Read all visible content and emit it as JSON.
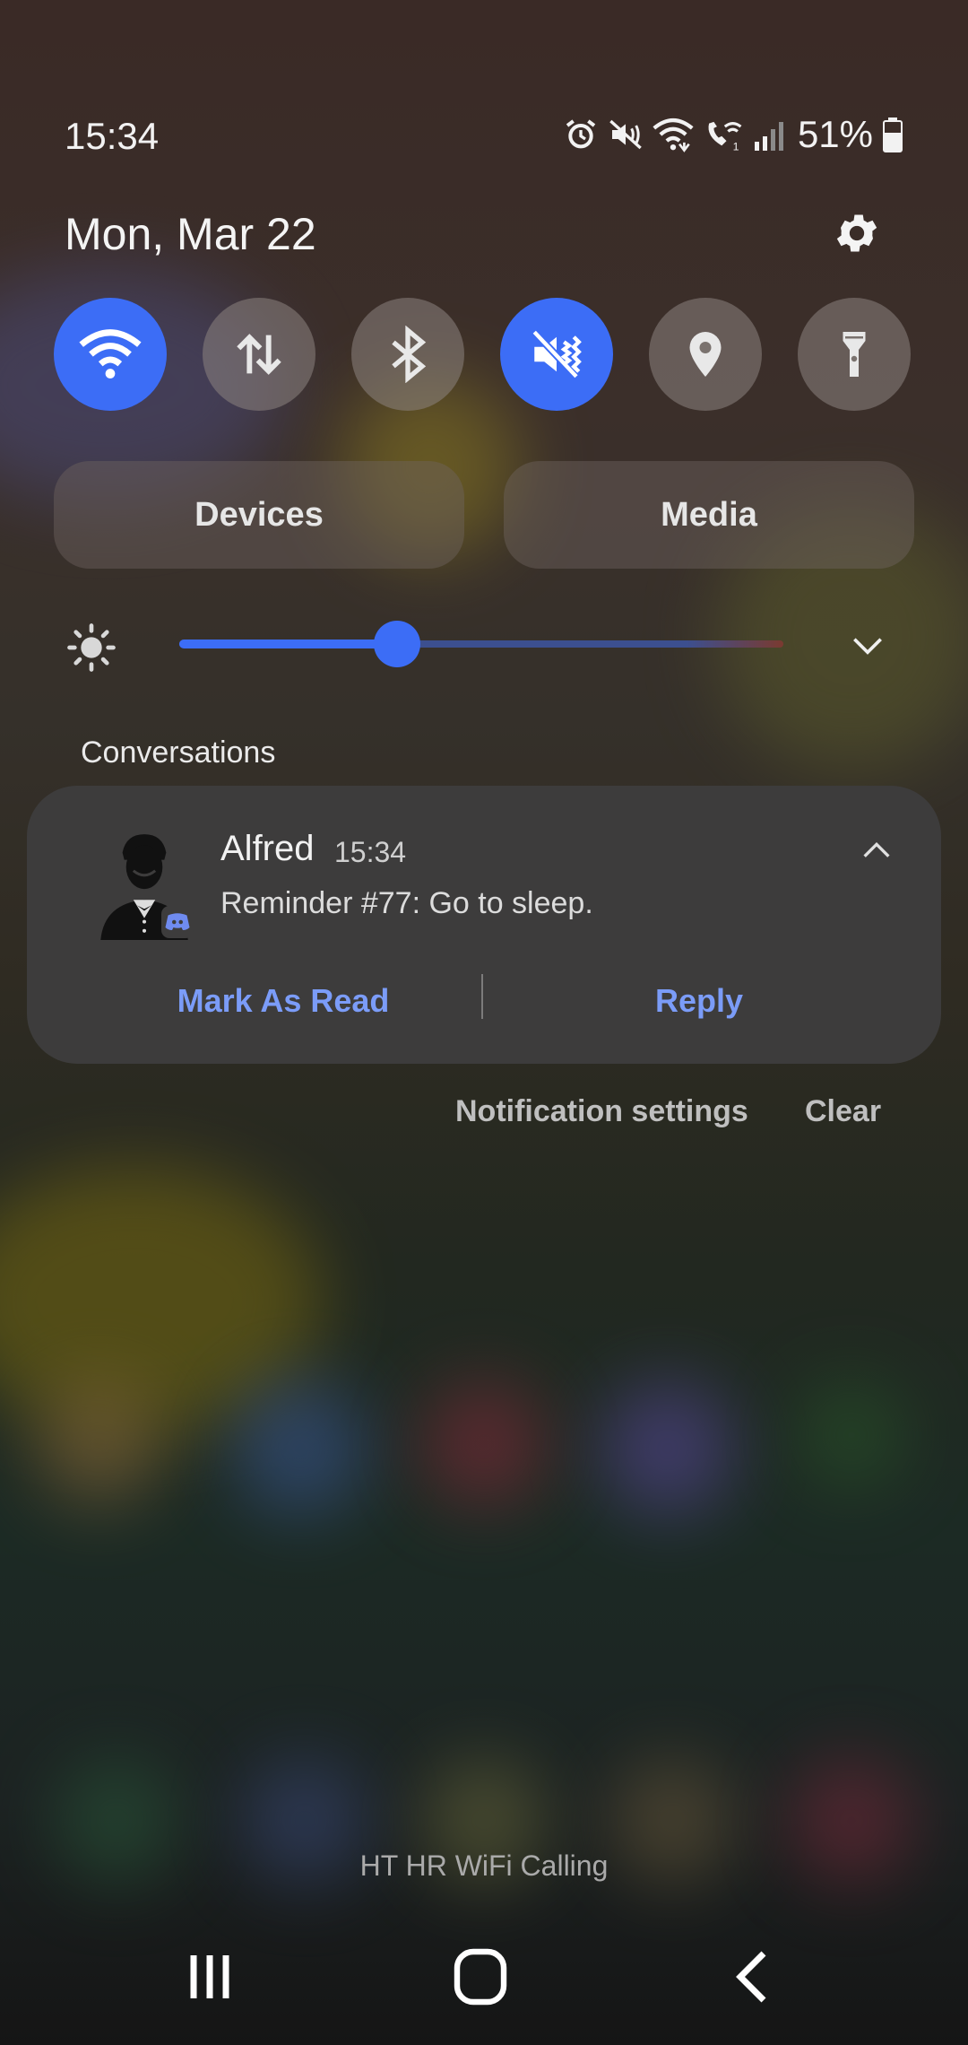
{
  "status_bar": {
    "time": "15:34",
    "battery_text": "51%",
    "icons": [
      "alarm-icon",
      "mute-icon",
      "wifi-icon",
      "wifi-calling-icon",
      "signal-icon",
      "battery-icon"
    ]
  },
  "header": {
    "date": "Mon, Mar 22",
    "settings_icon": "gear-icon"
  },
  "quick_settings": [
    {
      "icon": "wifi-icon",
      "on": true
    },
    {
      "icon": "mobile-data-icon",
      "on": false
    },
    {
      "icon": "bluetooth-icon",
      "on": false
    },
    {
      "icon": "mute-icon",
      "on": true
    },
    {
      "icon": "location-icon",
      "on": false
    },
    {
      "icon": "flashlight-icon",
      "on": false
    }
  ],
  "pills": {
    "devices": "Devices",
    "media": "Media"
  },
  "brightness": {
    "level": 0.36,
    "icon": "brightness-icon"
  },
  "conversations": {
    "label": "Conversations",
    "notification": {
      "sender": "Alfred",
      "time": "15:34",
      "message": "Reminder #77: Go to sleep.",
      "actions": {
        "mark_read": "Mark As Read",
        "reply": "Reply"
      }
    }
  },
  "footer": {
    "settings": "Notification settings",
    "clear": "Clear"
  },
  "carrier": "HT HR WiFi Calling",
  "colors": {
    "accent": "#3c6df6",
    "action_text": "#7b9cf8",
    "card": "#3d3c3c"
  },
  "nav": [
    "recents-icon",
    "home-icon",
    "back-icon"
  ]
}
